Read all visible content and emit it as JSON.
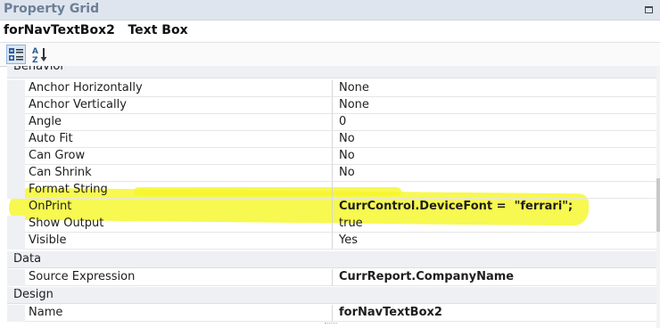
{
  "window": {
    "title": "Property Grid"
  },
  "selected_object": {
    "name": "forNavTextBox2   Text Box"
  },
  "toolbar": {
    "categorized_icon": "categorized-icon",
    "alphabetical_icon": "sort-az-icon"
  },
  "categories": {
    "behavior": "Behavior",
    "data": "Data",
    "design": "Design"
  },
  "rows": {
    "anchor_h": {
      "name": "Anchor Horizontally",
      "value": "None"
    },
    "anchor_v": {
      "name": "Anchor Vertically",
      "value": "None"
    },
    "angle": {
      "name": "Angle",
      "value": "0"
    },
    "auto_fit": {
      "name": "Auto Fit",
      "value": "No"
    },
    "can_grow": {
      "name": "Can Grow",
      "value": "No"
    },
    "can_shrink": {
      "name": "Can Shrink",
      "value": "No"
    },
    "format_string": {
      "name": "Format String",
      "value": ""
    },
    "on_print": {
      "name": "OnPrint",
      "value": "CurrControl.DeviceFont =  \"ferrari\";"
    },
    "show_output": {
      "name": "Show Output",
      "value": "true"
    },
    "visible": {
      "name": "Visible",
      "value": "Yes"
    },
    "source_expression": {
      "name": "Source Expression",
      "value": "CurrReport.CompanyName"
    },
    "name": {
      "name": "Name",
      "value": "forNavTextBox2"
    }
  },
  "colors": {
    "title_bar": "#dfe5ee",
    "title_text": "#6d7f97",
    "category_bg": "#eef0f3",
    "highlight": "#f5f72a"
  }
}
